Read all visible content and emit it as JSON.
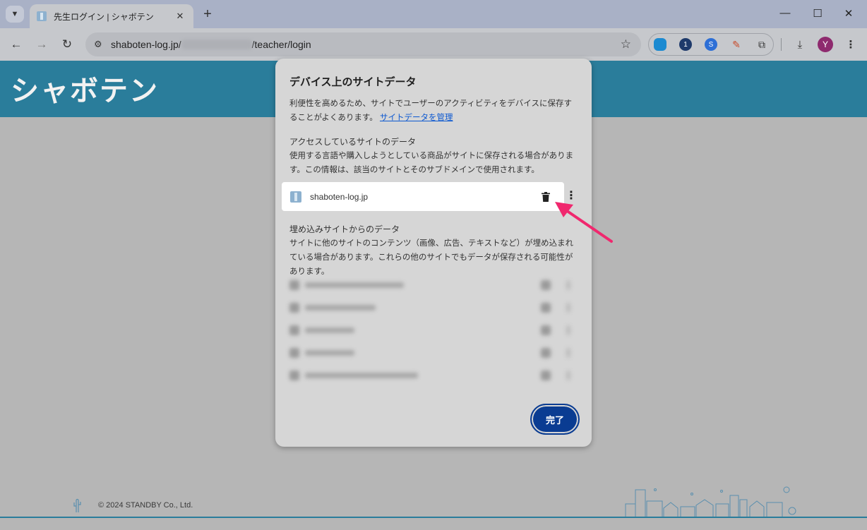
{
  "browser": {
    "tab": {
      "title": "先生ログイン | シャボテン"
    },
    "address": {
      "url_prefix": "shaboten-log.jp/",
      "url_suffix": "/teacher/login"
    },
    "profile_initial": "Y"
  },
  "page": {
    "logo": "シャボテン",
    "copyright": "© 2024 STANDBY Co., Ltd."
  },
  "dialog": {
    "title": "デバイス上のサイトデータ",
    "description": "利便性を高めるため、サイトでユーザーのアクティビティをデバイスに保存することがよくあります。",
    "manage_link": "サイトデータを管理",
    "visited_section": {
      "heading": "アクセスしているサイトのデータ",
      "body": "使用する言語や購入しようとしている商品がサイトに保存される場合があります。この情報は、該当のサイトとそのサブドメインで使用されます。"
    },
    "visited_site": {
      "name": "shaboten-log.jp"
    },
    "embedded_section": {
      "heading": "埋め込みサイトからのデータ",
      "body": "サイトに他のサイトのコンテンツ（画像、広告、テキストなど）が埋め込まれている場合があります。これらの他のサイトでもデータが保存される可能性があります。"
    },
    "done_label": "完了"
  },
  "colors": {
    "accent": "#0a3c92",
    "header": "#2a7d9b",
    "annotation_arrow": "#f0286e"
  }
}
